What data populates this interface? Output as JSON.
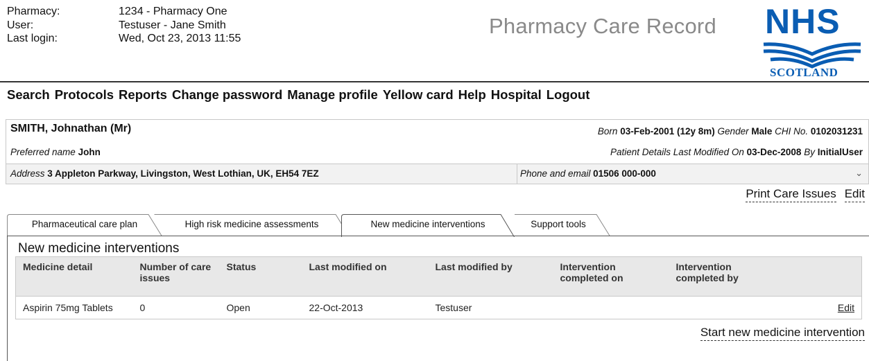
{
  "header": {
    "rows": [
      {
        "label": "Pharmacy:",
        "value": "1234 - Pharmacy One"
      },
      {
        "label": "User:",
        "value": "Testuser - Jane Smith"
      },
      {
        "label": "Last login:",
        "value": "Wed, Oct 23, 2013 11:55"
      }
    ],
    "app_title": "Pharmacy Care Record",
    "logo_text": "NHS",
    "logo_subtext": "SCOTLAND"
  },
  "nav": [
    "Search",
    "Protocols",
    "Reports",
    "Change password",
    "Manage profile",
    "Yellow card",
    "Help",
    "Hospital",
    "Logout"
  ],
  "patient": {
    "name": "SMITH, Johnathan (Mr)",
    "born_label": "Born",
    "born_value": "03-Feb-2001",
    "age": "(12y 8m)",
    "gender_label": "Gender",
    "gender_value": "Male",
    "chi_label": "CHI No.",
    "chi_value": "0102031231",
    "preferred_label": "Preferred name",
    "preferred_value": "John",
    "modified_label": "Patient Details Last Modified On",
    "modified_value": "03-Dec-2008",
    "by_label": "By",
    "by_value": "InitialUser",
    "address_label": "Address",
    "address_value": "3 Appleton Parkway, Livingston, West Lothian, UK, EH54 7EZ",
    "phone_label": "Phone and email",
    "phone_value": "01506 000-000"
  },
  "actions": {
    "print_care_issues": "Print Care Issues",
    "edit": "Edit"
  },
  "tabs": [
    {
      "label": "Pharmaceutical care plan",
      "active": false
    },
    {
      "label": "High risk medicine assessments",
      "active": false
    },
    {
      "label": "New medicine interventions",
      "active": true
    },
    {
      "label": "Support tools",
      "active": false
    }
  ],
  "panel": {
    "title": "New medicine interventions",
    "columns": [
      "Medicine detail",
      "Number of care issues",
      "Status",
      "Last modified on",
      "Last modified by",
      "Intervention completed on",
      "Intervention completed by",
      ""
    ],
    "rows": [
      {
        "medicine": "Aspirin 75mg Tablets",
        "care_issues": "0",
        "status": "Open",
        "modified_on": "22-Oct-2013",
        "modified_by": "Testuser",
        "completed_on": "",
        "completed_by": "",
        "action": "Edit"
      }
    ],
    "start_link": "Start new medicine intervention"
  },
  "colors": {
    "nhs_blue": "#0a5db3",
    "title_grey": "#8a8a8a",
    "header_bg": "#e8e8e8"
  }
}
